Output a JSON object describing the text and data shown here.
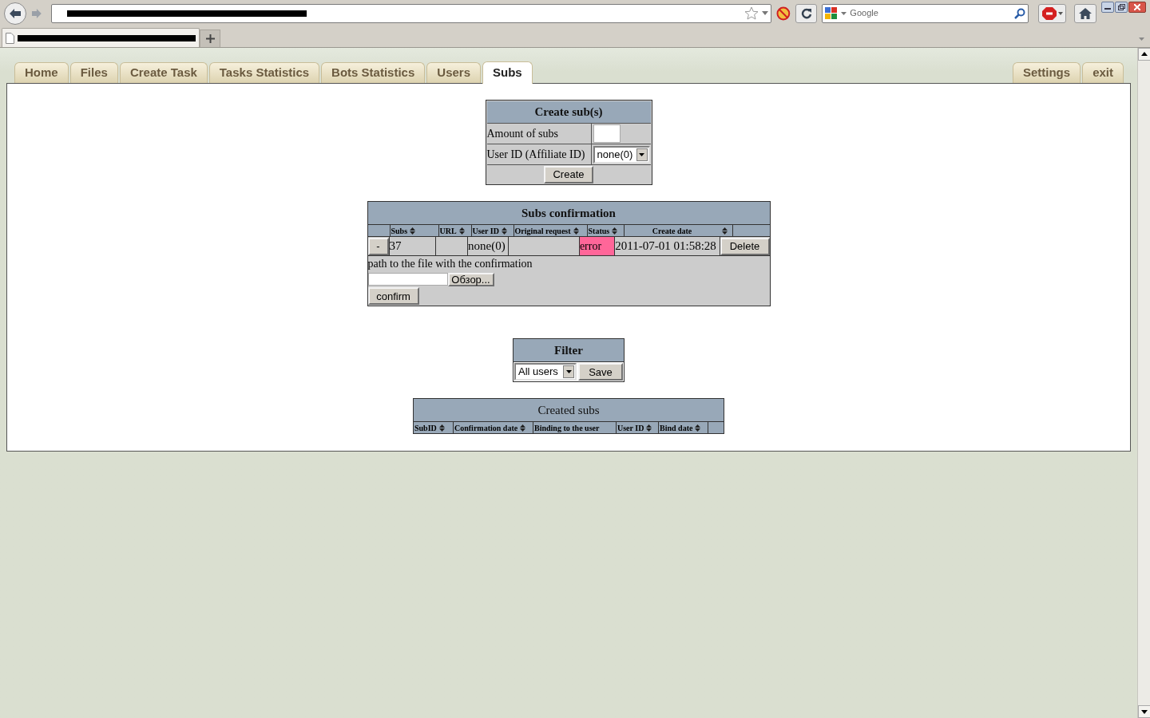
{
  "browser": {
    "search_placeholder": "Google"
  },
  "nav_tabs": [
    {
      "label": "Home",
      "selected": false
    },
    {
      "label": "Files",
      "selected": false
    },
    {
      "label": "Create Task",
      "selected": false
    },
    {
      "label": "Tasks Statistics",
      "selected": false
    },
    {
      "label": "Bots Statistics",
      "selected": false
    },
    {
      "label": "Users",
      "selected": false
    },
    {
      "label": "Subs",
      "selected": true
    }
  ],
  "right_tabs": [
    {
      "label": "Settings",
      "selected": false
    },
    {
      "label": "exit",
      "selected": false
    }
  ],
  "create_subs": {
    "title": "Create sub(s)",
    "rows": [
      {
        "kind": "input",
        "label": "Amount of subs"
      },
      {
        "kind": "select",
        "label": "User ID (Affiliate ID)",
        "value": "none(0)"
      }
    ],
    "button": "Create"
  },
  "confirmation": {
    "title": "Subs confirmation",
    "columns": [
      {
        "label": "Subs",
        "sortable": true
      },
      {
        "label": "URL",
        "sortable": true
      },
      {
        "label": "User ID",
        "sortable": true
      },
      {
        "label": "Original request",
        "sortable": true
      },
      {
        "label": "Status",
        "sortable": true
      },
      {
        "label": "Create date",
        "sortable": true
      }
    ],
    "rows": [
      {
        "toggle": "-",
        "subs": "37",
        "user_id": "none(0)",
        "status": {
          "text": "error",
          "color": "#ff6699"
        },
        "create_date": "2011-07-01 01:58:28",
        "action": "Delete"
      }
    ],
    "path_label": "path to the file with the confirmation",
    "browse_button": "Обзор...",
    "confirm_button": "confirm"
  },
  "filter": {
    "title": "Filter",
    "select": "All users",
    "button": "Save"
  },
  "created_subs": {
    "title": "Created subs",
    "columns": [
      {
        "label": "SubID",
        "sortable": true
      },
      {
        "label": "Confirmation date",
        "sortable": true
      },
      {
        "label": "Binding to the user",
        "sortable": false
      },
      {
        "label": "User ID",
        "sortable": true
      },
      {
        "label": "Bind date",
        "sortable": true
      }
    ]
  }
}
